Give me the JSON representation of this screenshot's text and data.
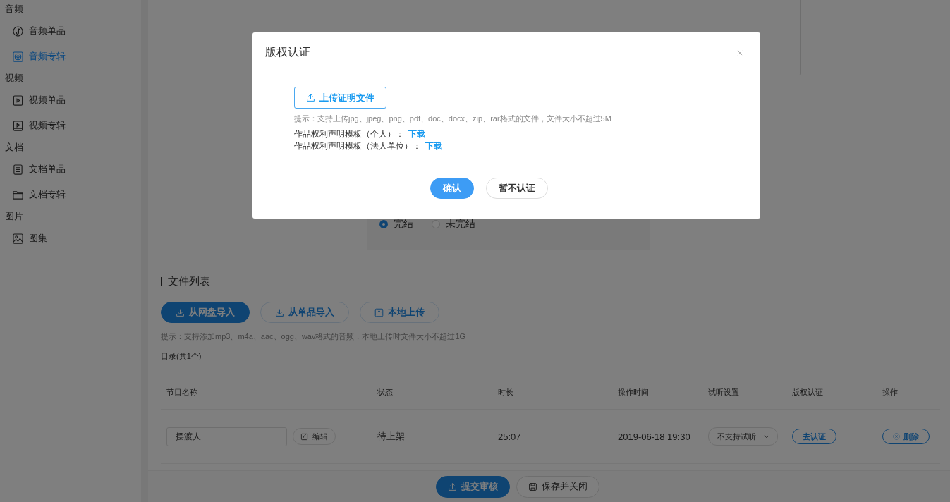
{
  "sidebar": {
    "groups": [
      {
        "title": "音频",
        "items": [
          {
            "label": "音频单品",
            "selected": false
          },
          {
            "label": "音频专辑",
            "selected": true
          }
        ]
      },
      {
        "title": "视频",
        "items": [
          {
            "label": "视频单品",
            "selected": false
          },
          {
            "label": "视频专辑",
            "selected": false
          }
        ]
      },
      {
        "title": "文档",
        "items": [
          {
            "label": "文档单品",
            "selected": false
          },
          {
            "label": "文档专辑",
            "selected": false
          }
        ]
      },
      {
        "title": "图片",
        "items": [
          {
            "label": "图集",
            "selected": false
          }
        ]
      }
    ]
  },
  "form": {
    "radios": [
      {
        "label": "完结",
        "selected": true
      },
      {
        "label": "未完结",
        "selected": false
      }
    ]
  },
  "file_list": {
    "title": "文件列表",
    "buttons": [
      {
        "label": "从网盘导入",
        "kind": "primary"
      },
      {
        "label": "从单品导入",
        "kind": "default"
      },
      {
        "label": "本地上传",
        "kind": "default"
      }
    ],
    "hint": "提示：支持添加mp3、m4a、aac、ogg、wav格式的音频，本地上传时文件大小不超过1G",
    "count": "目录(共1个)",
    "table": {
      "columns": [
        "节目名称",
        "状态",
        "时长",
        "操作时间",
        "试听设置",
        "版权认证",
        "操作"
      ],
      "rows": [
        {
          "name": "摆渡人",
          "edit": "编辑",
          "status": "待上架",
          "duration": "25:07",
          "time": "2019-06-18 19:30",
          "preview": "不支持试听",
          "certify": "去认证",
          "delete": "删除"
        }
      ]
    }
  },
  "footer": {
    "buttons": [
      {
        "label": "提交审核",
        "kind": "primary"
      },
      {
        "label": "保存并关闭",
        "kind": "default"
      }
    ]
  },
  "modal": {
    "title": "版权认证",
    "upload_button": "上传证明文件",
    "hint": "提示：支持上传jpg、jpeg、png、pdf、doc、docx、zip、rar格式的文件，文件大小不超过5M",
    "templates": [
      {
        "label": "作品权利声明模板（个人）：",
        "link": "下载"
      },
      {
        "label": "作品权利声明模板（法人单位）：",
        "link": "下载"
      }
    ],
    "buttons": [
      {
        "label": "确认",
        "kind": "primary"
      },
      {
        "label": "暂不认证",
        "kind": "default"
      }
    ]
  }
}
